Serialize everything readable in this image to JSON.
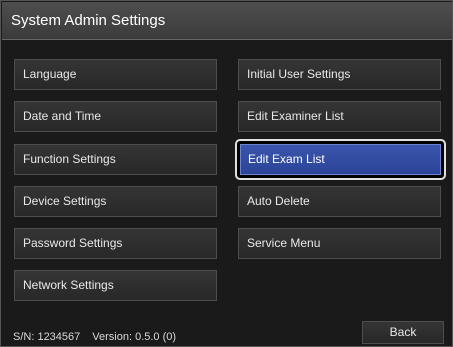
{
  "window": {
    "title": "System Admin Settings"
  },
  "menu": {
    "left": [
      {
        "label": "Language"
      },
      {
        "label": "Date and Time"
      },
      {
        "label": "Function Settings"
      },
      {
        "label": "Device Settings"
      },
      {
        "label": "Password Settings"
      },
      {
        "label": "Network Settings"
      }
    ],
    "right": [
      {
        "label": "Initial User Settings"
      },
      {
        "label": "Edit Examiner List"
      },
      {
        "label": "Edit Exam List",
        "selected": true
      },
      {
        "label": "Auto Delete"
      },
      {
        "label": "Service Menu"
      }
    ]
  },
  "footer": {
    "serial": "S/N: 1234567",
    "version": "Version: 0.5.0 (0)",
    "back_label": "Back"
  },
  "colors": {
    "selected_fill": "#2f4aa0",
    "selected_outline": "#e0e0e0",
    "background": "#1a1a1a",
    "titlebar": "#444444"
  }
}
